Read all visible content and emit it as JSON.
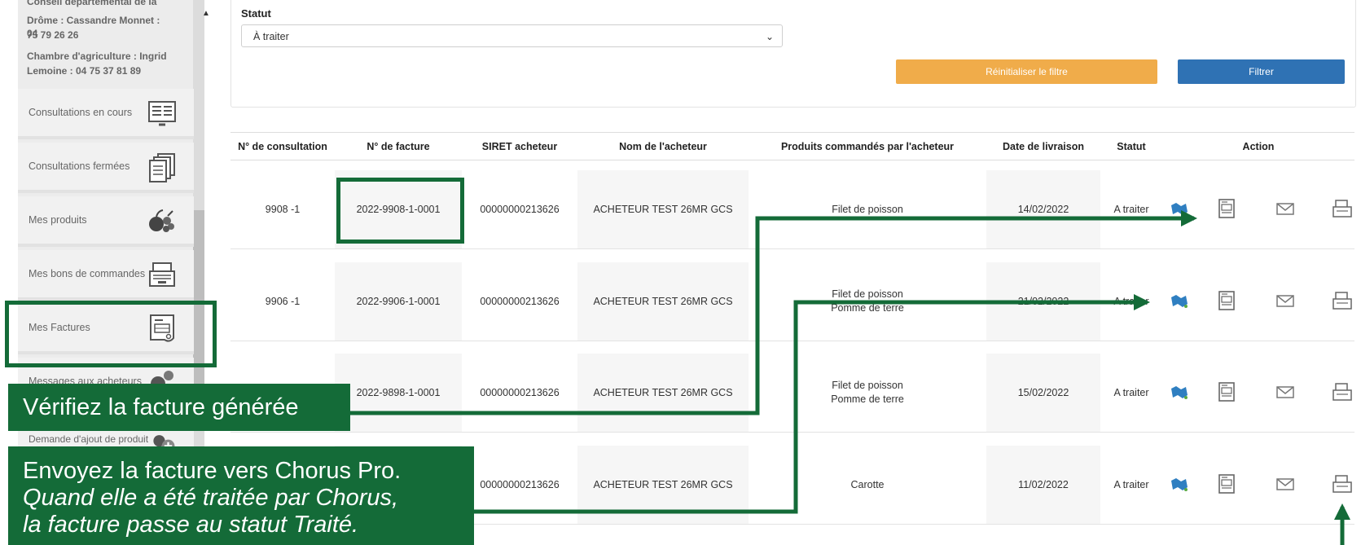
{
  "sidebar": {
    "contacts": [
      "Conseil départemental de la",
      "Drôme : Cassandre Monnet : 04",
      "75 79 26 26",
      "Chambre d'agriculture : Ingrid",
      "Lemoine : 04 75 37 81 89"
    ],
    "items": [
      {
        "label": "Consultations en cours",
        "icon": "list-board-icon"
      },
      {
        "label": "Consultations fermées",
        "icon": "documents-stack-icon"
      },
      {
        "label": "Mes produits",
        "icon": "fruit-basket-icon"
      },
      {
        "label": "Mes bons de commandes",
        "icon": "cash-register-icon"
      },
      {
        "label": "Mes Factures",
        "icon": "invoice-icon"
      },
      {
        "label": "Messages aux acheteurs",
        "icon": "message-icon"
      },
      {
        "label": "Demande d'ajout de produit",
        "icon": "add-product-icon"
      }
    ]
  },
  "filter": {
    "statut_label": "Statut",
    "statut_value": "À traiter",
    "reset_label": "Réinitialiser le filtre",
    "filter_label": "Filtrer"
  },
  "table": {
    "headers": [
      "N° de consultation",
      "N° de facture",
      "SIRET acheteur",
      "Nom de l'acheteur",
      "Produits commandés par l'acheteur",
      "Date de livraison",
      "Statut",
      "Action"
    ],
    "rows": [
      {
        "consultation": "9908 -1",
        "facture": "2022-9908-1-0001",
        "siret": "00000000213626",
        "acheteur": "ACHETEUR TEST 26MR GCS",
        "produits": [
          "Filet de poisson"
        ],
        "date": "14/02/2022",
        "statut": "A traiter"
      },
      {
        "consultation": "9906 -1",
        "facture": "2022-9906-1-0001",
        "siret": "00000000213626",
        "acheteur": "ACHETEUR TEST 26MR GCS",
        "produits": [
          "Filet de poisson",
          "Pomme de terre"
        ],
        "date": "21/02/2022",
        "statut": "A traiter"
      },
      {
        "consultation": "",
        "facture": "2022-9898-1-0001",
        "siret": "00000000213626",
        "acheteur": "ACHETEUR TEST 26MR GCS",
        "produits": [
          "Filet de poisson",
          "Pomme de terre"
        ],
        "date": "15/02/2022",
        "statut": "A traiter"
      },
      {
        "consultation": "",
        "facture": "",
        "siret": "00000000213626",
        "acheteur": "ACHETEUR TEST 26MR GCS",
        "produits": [
          "Carotte"
        ],
        "date": "11/02/2022",
        "statut": "A traiter"
      }
    ],
    "action_icons": [
      "map-icon",
      "view-invoice-icon",
      "mail-icon",
      "send-chorus-icon"
    ]
  },
  "annotations": {
    "callout1": "Vérifiez la facture générée",
    "callout2_line1": "Envoyez la facture vers Chorus Pro.",
    "callout2_line2": "Quand elle a été traitée par Chorus,",
    "callout2_line3": "la facture passe au statut Traité."
  },
  "colors": {
    "annotation_green": "#146b38",
    "reset_orange": "#f0ac4a",
    "filter_blue": "#2f72b4"
  }
}
